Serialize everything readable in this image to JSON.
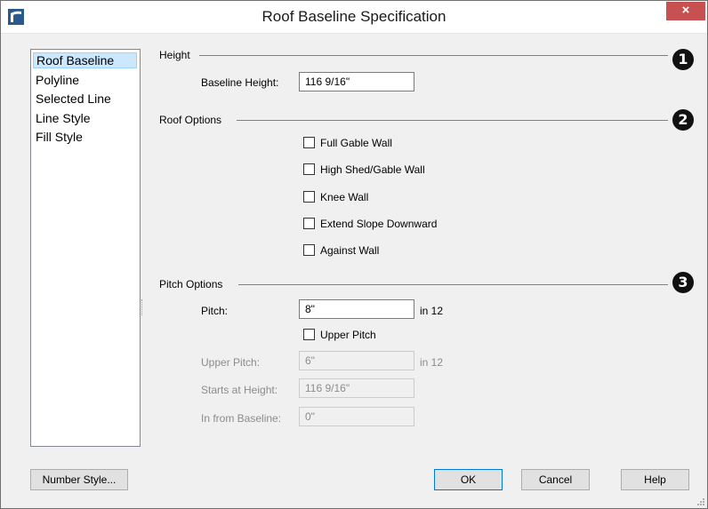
{
  "window": {
    "title": "Roof Baseline Specification",
    "close_icon": "×"
  },
  "sidebar": {
    "items": [
      {
        "label": "Roof Baseline",
        "selected": true
      },
      {
        "label": "Polyline",
        "selected": false
      },
      {
        "label": "Selected Line",
        "selected": false
      },
      {
        "label": "Line Style",
        "selected": false
      },
      {
        "label": "Fill Style",
        "selected": false
      }
    ]
  },
  "height_section": {
    "title": "Height",
    "badge": "1",
    "baseline_height_label": "Baseline Height:",
    "baseline_height_value": "116 9/16\""
  },
  "roof_options": {
    "title": "Roof Options",
    "badge": "2",
    "checkboxes": [
      {
        "label": "Full Gable Wall",
        "checked": false
      },
      {
        "label": "High Shed/Gable Wall",
        "checked": false
      },
      {
        "label": "Knee Wall",
        "checked": false
      },
      {
        "label": "Extend Slope Downward",
        "checked": false
      },
      {
        "label": "Against Wall",
        "checked": false
      }
    ]
  },
  "pitch_options": {
    "title": "Pitch Options",
    "badge": "3",
    "pitch_label": "Pitch:",
    "pitch_value": "8\"",
    "pitch_unit": "in 12",
    "upper_pitch_checkbox": {
      "label": "Upper Pitch",
      "checked": false
    },
    "upper_pitch_label": "Upper Pitch:",
    "upper_pitch_value": "6\"",
    "upper_pitch_unit": "in 12",
    "starts_at_height_label": "Starts at Height:",
    "starts_at_height_value": "116 9/16\"",
    "in_from_baseline_label": "In from Baseline:",
    "in_from_baseline_value": "0\""
  },
  "buttons": {
    "number_style": "Number Style...",
    "ok": "OK",
    "cancel": "Cancel",
    "help": "Help"
  },
  "colors": {
    "close_button": "#c75050",
    "selected_item": "#cce8ff",
    "default_button_border": "#0078d7"
  }
}
